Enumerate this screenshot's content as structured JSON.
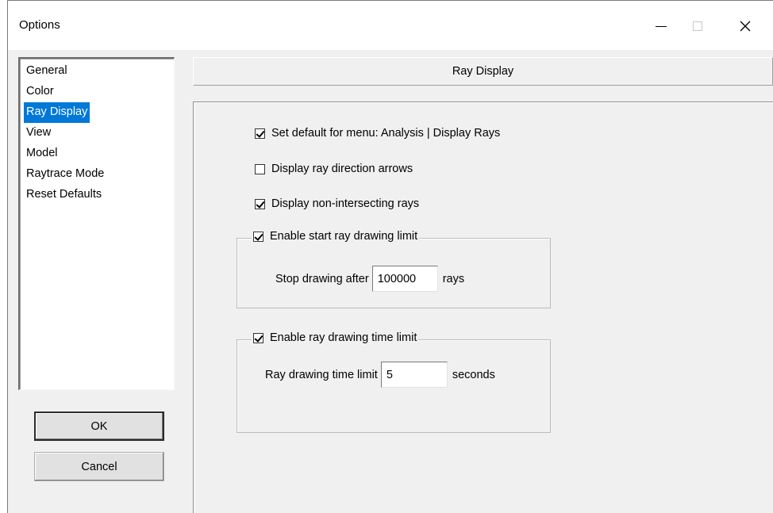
{
  "window": {
    "title": "Options",
    "controls": {
      "minimize": "minimize",
      "maximize": "maximize",
      "close": "✕"
    }
  },
  "sidebar": {
    "items": [
      {
        "label": "General",
        "selected": false
      },
      {
        "label": "Color",
        "selected": false
      },
      {
        "label": "Ray Display",
        "selected": true
      },
      {
        "label": "View",
        "selected": false
      },
      {
        "label": "Model",
        "selected": false
      },
      {
        "label": "Raytrace Mode",
        "selected": false
      },
      {
        "label": "Reset Defaults",
        "selected": false
      }
    ]
  },
  "buttons": {
    "ok": "OK",
    "cancel": "Cancel"
  },
  "panel": {
    "header": "Ray Display",
    "options": {
      "default_menu": {
        "label": "Set default for menu: Analysis | Display Rays",
        "checked": true
      },
      "direction_arrows": {
        "label": "Display ray direction arrows",
        "checked": false
      },
      "non_intersecting": {
        "label": "Display non-intersecting rays",
        "checked": true
      }
    },
    "ray_limit_group": {
      "label": "Enable start ray drawing limit",
      "checked": true,
      "field_label": "Stop drawing after",
      "value": "100000",
      "unit": "rays"
    },
    "time_limit_group": {
      "label": "Enable ray drawing time limit",
      "checked": true,
      "field_label": "Ray drawing time limit",
      "value": "5",
      "unit": "seconds"
    }
  },
  "colors": {
    "selection": "#0078d7",
    "window_bg": "#f0f0f0"
  }
}
